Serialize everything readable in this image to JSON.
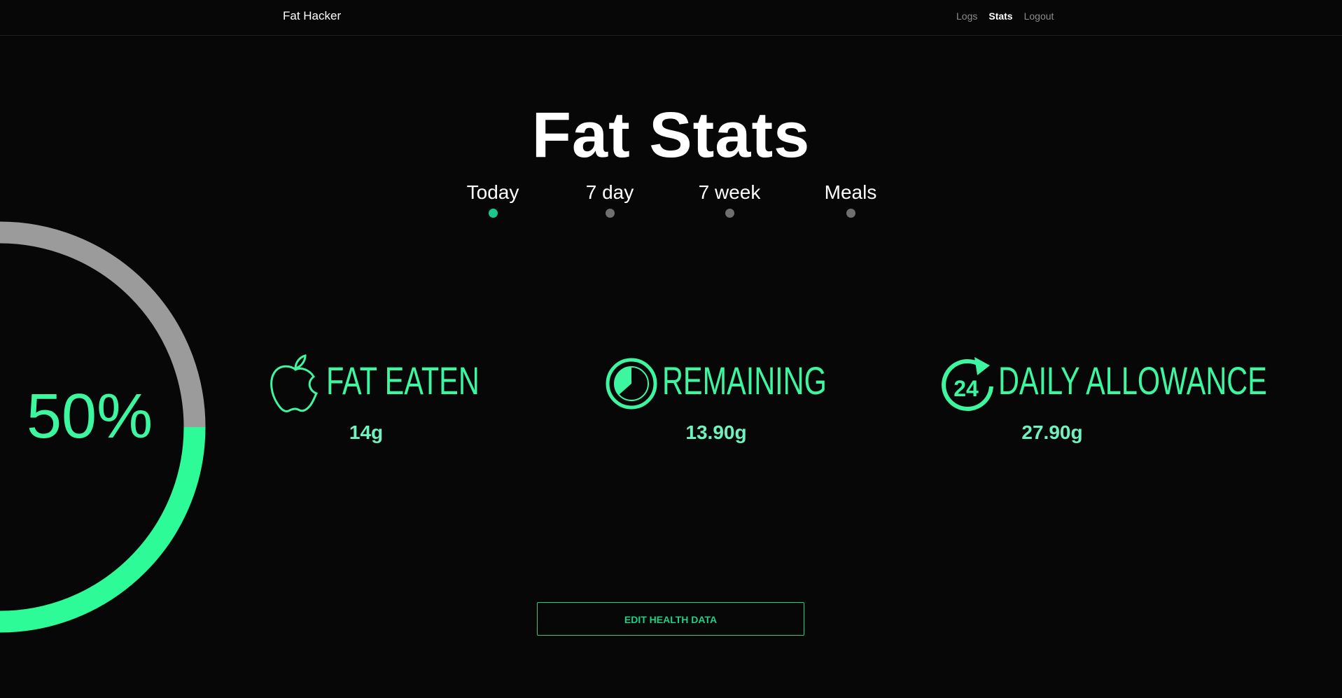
{
  "navbar": {
    "brand": "Fat Hacker",
    "links": [
      {
        "label": "Logs",
        "active": false
      },
      {
        "label": "Stats",
        "active": true
      },
      {
        "label": "Logout",
        "active": false
      }
    ]
  },
  "title": "Fat Stats",
  "tabs": [
    {
      "label": "Today",
      "active": true
    },
    {
      "label": "7 day",
      "active": false
    },
    {
      "label": "7 week",
      "active": false
    },
    {
      "label": "Meals",
      "active": false
    }
  ],
  "progress": {
    "percent_label": "50%",
    "fraction": 0.5,
    "colors": {
      "filled": "#2dfb97",
      "track": "#9b9b9b"
    }
  },
  "stats": [
    {
      "icon": "apple-icon",
      "label": "FAT EATEN",
      "value": "14g"
    },
    {
      "icon": "pie-clock-icon",
      "label": "REMAINING",
      "value": "13.90g"
    },
    {
      "icon": "24-hour-icon",
      "label": "DAILY ALLOWANCE",
      "value": "27.90g"
    }
  ],
  "edit_button": {
    "label": "EDIT HEALTH DATA"
  },
  "colors": {
    "accent": "#3df6a0",
    "button": "#1fcf85",
    "background": "#070707"
  }
}
